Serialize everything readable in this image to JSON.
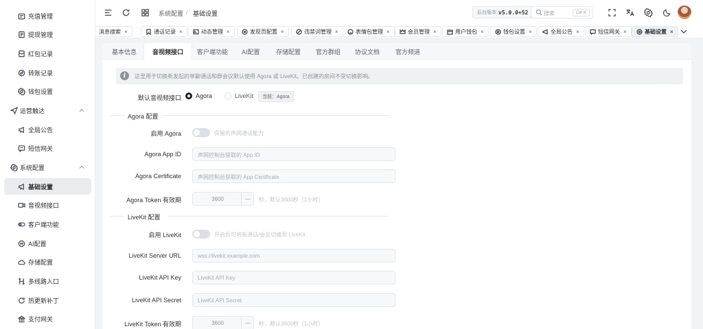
{
  "sidebar": {
    "items": [
      {
        "label": "充值管理",
        "icon": "wallet-icon",
        "type": "sub"
      },
      {
        "label": "提现管理",
        "icon": "document-icon",
        "type": "sub"
      },
      {
        "label": "红包记录",
        "icon": "red-envelope-icon",
        "type": "sub"
      },
      {
        "label": "转账记录",
        "icon": "transfer-icon",
        "type": "sub"
      },
      {
        "label": "钱包设置",
        "icon": "gear-icon",
        "type": "sub"
      },
      {
        "label": "运营触达",
        "icon": "send-icon",
        "type": "group"
      },
      {
        "label": "全局公告",
        "icon": "megaphone-icon",
        "type": "sub"
      },
      {
        "label": "短信网关",
        "icon": "message-icon",
        "type": "sub"
      },
      {
        "label": "系统配置",
        "icon": "gear-icon",
        "type": "group"
      },
      {
        "label": "基础设置",
        "icon": "megaphone-icon",
        "type": "sub",
        "active": true
      },
      {
        "label": "音视频接口",
        "icon": "video-icon",
        "type": "sub"
      },
      {
        "label": "客户端功能",
        "icon": "toggle-icon",
        "type": "sub"
      },
      {
        "label": "AI配置",
        "icon": "ai-icon",
        "type": "sub"
      },
      {
        "label": "存储配置",
        "icon": "cloud-icon",
        "type": "sub"
      },
      {
        "label": "多线路入口",
        "icon": "route-icon",
        "type": "sub"
      },
      {
        "label": "热更新补丁",
        "icon": "refresh-icon",
        "type": "sub"
      },
      {
        "label": "支付网关",
        "icon": "bank-icon",
        "type": "sub"
      }
    ]
  },
  "header": {
    "breadcrumb_parent": "系统配置",
    "breadcrumb_sep": "/",
    "breadcrumb_current": "基础设置",
    "version_label": "后台版本",
    "version_value": "v5.0.0+52",
    "search_placeholder": "搜索",
    "search_shortcut": "Ctrl K"
  },
  "tabs": [
    {
      "label": "消息搜索",
      "icon": ""
    },
    {
      "label": "通话记录",
      "icon": "bookmark-icon"
    },
    {
      "label": "动态管理",
      "icon": "image-icon"
    },
    {
      "label": "发现页配置",
      "icon": "compass-icon"
    },
    {
      "label": "违禁词管理",
      "icon": "ban-icon"
    },
    {
      "label": "表情包管理",
      "icon": "smile-icon"
    },
    {
      "label": "会员管理",
      "icon": "crown-icon"
    },
    {
      "label": "用户钱包",
      "icon": "wallet-icon"
    },
    {
      "label": "钱包设置",
      "icon": "gear-icon"
    },
    {
      "label": "全局公告",
      "icon": "megaphone-icon"
    },
    {
      "label": "短信网关",
      "icon": "message-icon"
    },
    {
      "label": "基础设置",
      "icon": "gear-icon",
      "active": true
    }
  ],
  "tab_close": "×",
  "content_tabs": [
    "基本信息",
    "音视频接口",
    "客户端功能",
    "AI配置",
    "存储配置",
    "官方群组",
    "协议文档",
    "官方频道"
  ],
  "alert_text": "这里用于切换新发起的单聊通话和群会议默认使用 Agora 或 LiveKit。已创建的房间不受切换影响。",
  "alert_icon": "i",
  "form": {
    "default_label": "默认音视频接口",
    "radio_agora": "Agora",
    "radio_livekit": "LiveKit",
    "current_badge": "当前：Agora",
    "agora_section": "Agora 配置",
    "agora_enable_label": "启用 Agora",
    "agora_enable_hint": "保留的声网通话能力",
    "agora_enabled": false,
    "agora_appid_label": "Agora App ID",
    "agora_appid_placeholder": "声网控制台获取的 App ID",
    "agora_cert_label": "Agora Certificate",
    "agora_cert_placeholder": "声网控制台获取的 App Certificate",
    "agora_token_label": "Agora Token 有效期",
    "agora_token_value": "3600",
    "agora_token_hint": "秒，默认3600秒（1小时）",
    "livekit_section": "LiveKit 配置",
    "livekit_enable_label": "启用 LiveKit",
    "livekit_enable_hint": "开启后可将新通话/会议切换到 LiveKit",
    "livekit_enabled": false,
    "livekit_url_label": "LiveKit Server URL",
    "livekit_url_placeholder": "wss://livekit.example.com",
    "livekit_key_label": "LiveKit API Key",
    "livekit_key_placeholder": "LiveKit API Key",
    "livekit_secret_label": "LiveKit API Secret",
    "livekit_secret_placeholder": "LiveKit API Secret",
    "livekit_token_label": "LiveKit Token 有效期",
    "livekit_token_value": "3600",
    "livekit_token_hint": "秒，默认3600秒（1小时）"
  }
}
